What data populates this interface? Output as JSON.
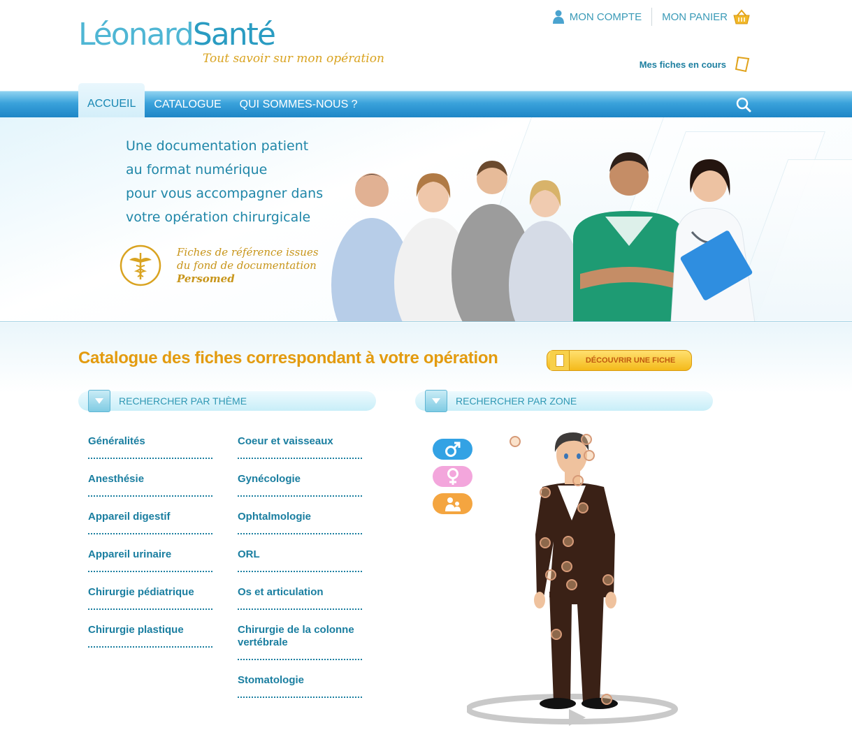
{
  "brand": {
    "logo_part1": "Léonard",
    "logo_part2": "Santé",
    "tagline": "Tout savoir sur mon opération",
    "color_primary": "#2a9cc2",
    "color_accent": "#e39b0f"
  },
  "top_links": {
    "account": "MON COMPTE",
    "cart": "MON PANIER",
    "my_sheets": "Mes fiches en cours",
    "account_icon": "user-icon",
    "cart_icon": "basket-icon",
    "sheets_icon": "notebook-icon"
  },
  "nav": {
    "items": [
      "ACCUEIL",
      "CATALOGUE",
      "QUI SOMMES-NOUS ?"
    ],
    "active": "ACCUEIL",
    "search_icon": "search-icon"
  },
  "hero": {
    "lines": [
      "Une documentation patient",
      "au format numérique",
      "pour vous accompagner dans",
      "votre opération chirurgicale"
    ],
    "persomed_line1": "Fiches de référence issues",
    "persomed_line2": "du fond de documentation",
    "persomed_line3": "Persomed"
  },
  "catalogue": {
    "title": "Catalogue des fiches correspondant à votre opération",
    "discover_button": "DÉCOUVRIR UNE FICHE",
    "theme_header": "RECHERCHER PAR THÈME",
    "zone_header": "RECHERCHER PAR ZONE",
    "themes_left": [
      "Généralités",
      "Anesthésie",
      "Appareil digestif",
      "Appareil urinaire",
      "Chirurgie pédiatrique",
      "Chirurgie plastique"
    ],
    "themes_right": [
      "Coeur et vaisseaux",
      "Gynécologie",
      "Ophtalmologie",
      "ORL",
      "Os et articulation",
      "Chirurgie de la colonne vertébrale",
      "Stomatologie"
    ]
  },
  "zone": {
    "genders": [
      "male",
      "female",
      "child"
    ],
    "gender_colors": [
      "#33a2e4",
      "#f3a6dc",
      "#f4a540"
    ]
  }
}
